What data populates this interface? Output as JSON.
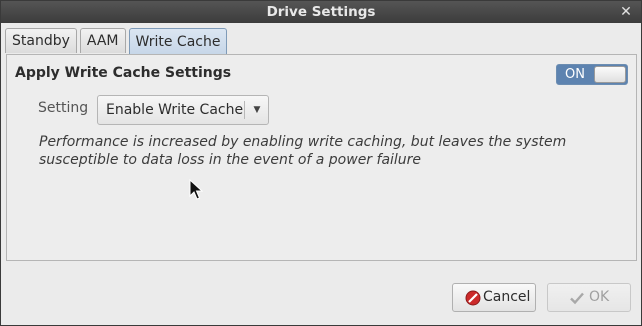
{
  "window": {
    "title": "Drive Settings"
  },
  "tabs": [
    {
      "label": "Standby",
      "active": false
    },
    {
      "label": "AAM",
      "active": false
    },
    {
      "label": "Write Cache",
      "active": true
    }
  ],
  "section": {
    "title": "Apply Write Cache Settings",
    "toggle": {
      "state_label": "ON",
      "on": true
    }
  },
  "setting": {
    "label": "Setting",
    "selected": "Enable Write Cache"
  },
  "description": "Performance is increased by enabling write caching, but leaves the system susceptible to data loss in the event of a power failure",
  "buttons": {
    "cancel": {
      "label": "Cancel",
      "icon": "cancel-icon",
      "enabled": true
    },
    "ok": {
      "label": "OK",
      "icon": "checkmark-icon",
      "enabled": false
    }
  },
  "colors": {
    "accent": "#5d83b0",
    "titlebar": "#444444",
    "cancel_icon": "#cc2a2a"
  }
}
